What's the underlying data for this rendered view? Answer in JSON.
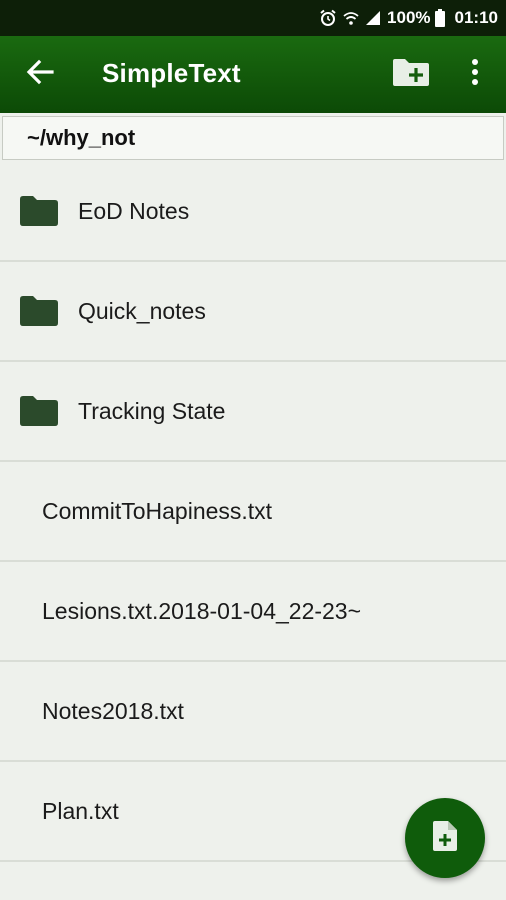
{
  "status_bar": {
    "battery_percent": "100%",
    "time": "01:10",
    "icons": [
      "alarm-icon",
      "wifi-icon",
      "signal-icon",
      "battery-icon"
    ]
  },
  "app_bar": {
    "title": "SimpleText",
    "icons": [
      "back-arrow-icon",
      "new-folder-icon",
      "overflow-menu-icon"
    ]
  },
  "path": "~/why_not",
  "folders": [
    {
      "name": "EoD Notes"
    },
    {
      "name": "Quick_notes"
    },
    {
      "name": "Tracking State"
    }
  ],
  "files": [
    {
      "name": "CommitToHapiness.txt"
    },
    {
      "name": "Lesions.txt.2018-01-04_22-23~"
    },
    {
      "name": "Notes2018.txt"
    },
    {
      "name": "Plan.txt"
    }
  ],
  "fab": {
    "icon": "new-file-icon"
  },
  "colors": {
    "app_bar": "#0c4a06",
    "status_bar": "#0d1f08",
    "folder_icon": "#2b4a2b",
    "fab": "#0f5c0b",
    "background": "#eef1ec"
  }
}
